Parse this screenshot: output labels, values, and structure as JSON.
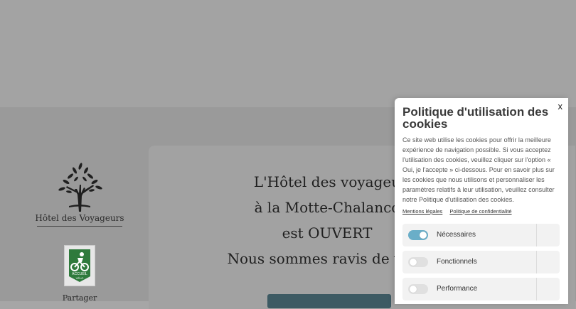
{
  "logo": {
    "name": "Hôtel des Voyageurs"
  },
  "badge": {
    "line1": "ACCUEIL",
    "line2": "VÉLO"
  },
  "sidebar": {
    "share_label": "Partager"
  },
  "main": {
    "headline_lines": [
      "L'Hôtel des voyageu",
      "à la Motte-Chalanco",
      "est OUVERT",
      "Nous sommes ravis de vous"
    ]
  },
  "cookie_banner": {
    "close_label": "x",
    "title": "Politique d'utilisation des cookies",
    "description": "Ce site web utilise les cookies pour offrir la meilleure expérience de navigation possible. Si vous acceptez l'utilisation des cookies, veuillez cliquer sur l'option « Oui, je l'accepte » ci-dessous. Pour en savoir plus sur les cookies que nous utilisons et personnaliser les paramètres relatifs à leur utilisation, veuillez consulter notre Politique d'utilisation des cookies.",
    "links": [
      "Mentions légales",
      "Politique de confidentialité"
    ],
    "preferences": [
      {
        "label": "Nécessaires",
        "enabled": true
      },
      {
        "label": "Fonctionnels",
        "enabled": false
      },
      {
        "label": "Performance",
        "enabled": false
      }
    ]
  },
  "colors": {
    "cta": "#3d5a63",
    "toggle_on": "#6aaec8"
  }
}
